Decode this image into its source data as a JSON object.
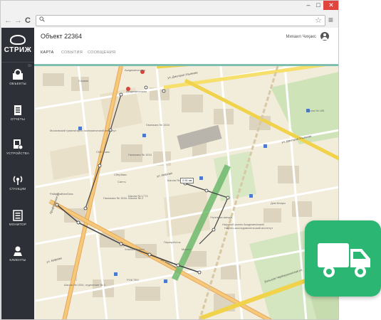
{
  "browser": {
    "window_controls": {
      "minimize": "–",
      "maximize": "□",
      "close": "✕"
    },
    "nav": {
      "back": "←",
      "forward": "→",
      "reload": "C"
    },
    "address": {
      "search_icon": "search-icon",
      "value": "",
      "star_icon": "star-icon"
    },
    "menu_icon": "hamburger-icon"
  },
  "sidebar": {
    "logo_text": "СТРИЖ",
    "items": [
      {
        "label": "ОБЪЕКТЫ",
        "icon": "map-marker-icon"
      },
      {
        "label": "ОТЧЕТЫ",
        "icon": "document-icon"
      },
      {
        "label": "УСТРОЙСТВА",
        "icon": "device-icon"
      },
      {
        "label": "СТАНЦИИ",
        "icon": "antenna-icon"
      },
      {
        "label": "МОНИТОР",
        "icon": "monitor-icon"
      },
      {
        "label": "КЛИЕНТЫ",
        "icon": "user-icon"
      }
    ]
  },
  "header": {
    "title": "Объект 22364",
    "user_name": "Михаил Чиҳакс",
    "tabs": [
      {
        "label": "КАРТА",
        "active": true
      },
      {
        "label": "СОБЫТИЯ",
        "active": false
      },
      {
        "label": "СООБЩЕНИЯ",
        "active": false
      }
    ]
  },
  "map": {
    "distance_label": "2.51 км",
    "labels": [
      {
        "text": "Академическая",
        "type": "metro"
      },
      {
        "text": "Академическая",
        "type": "metro"
      },
      {
        "text": "ул. Дмитрия Ульянова",
        "type": "street"
      },
      {
        "text": "ул. Дмитрия Ульянова",
        "type": "street"
      },
      {
        "text": "ул. Кедрова",
        "type": "street"
      },
      {
        "text": "ул. Кедрова",
        "type": "street"
      },
      {
        "text": "Профсоюзная ул.",
        "type": "street"
      },
      {
        "text": "ул. Вавилова",
        "type": "street"
      },
      {
        "text": "Большая Черёмушкинская ул.",
        "type": "street"
      },
      {
        "text": "Гимназия № 1534",
        "type": "poi"
      },
      {
        "text": "Гимназия № 1534",
        "type": "poi"
      },
      {
        "text": "Школа № 1534",
        "type": "poi"
      },
      {
        "text": "Школа № 1774",
        "type": "poi"
      },
      {
        "text": "Школа № 185",
        "type": "poi"
      },
      {
        "text": "Школа № 1534, отделение № 2",
        "type": "poi"
      },
      {
        "text": "Гимназия № 1534, Школа № 2",
        "type": "poi"
      },
      {
        "text": "СМП Банк",
        "type": "poi"
      },
      {
        "text": "Райффайзенбанк",
        "type": "poi"
      },
      {
        "text": "Сбербанк",
        "type": "poi"
      },
      {
        "text": "Славия",
        "type": "poi"
      },
      {
        "text": "Перекрёсток",
        "type": "poi"
      },
      {
        "text": "Магнит",
        "type": "poi"
      },
      {
        "text": "Сантъ",
        "type": "poi"
      },
      {
        "text": "Улыбка Радуги",
        "type": "poi"
      },
      {
        "text": "Утренняя звезда",
        "type": "poi"
      },
      {
        "text": "РОК ТЕХ",
        "type": "poi"
      },
      {
        "text": "Научно-исследовательский институт",
        "type": "poi"
      },
      {
        "text": "Научный рынок Академический",
        "type": "poi"
      },
      {
        "text": "Московский гуманитарно-экономический институт",
        "type": "poi"
      },
      {
        "text": "Дом Клары",
        "type": "poi"
      }
    ]
  },
  "badge": {
    "icon": "truck-icon",
    "color": "#2bb673"
  },
  "colors": {
    "sidebar": "#2e3037",
    "accent": "#7fbfb0",
    "close": "#e0443e"
  }
}
